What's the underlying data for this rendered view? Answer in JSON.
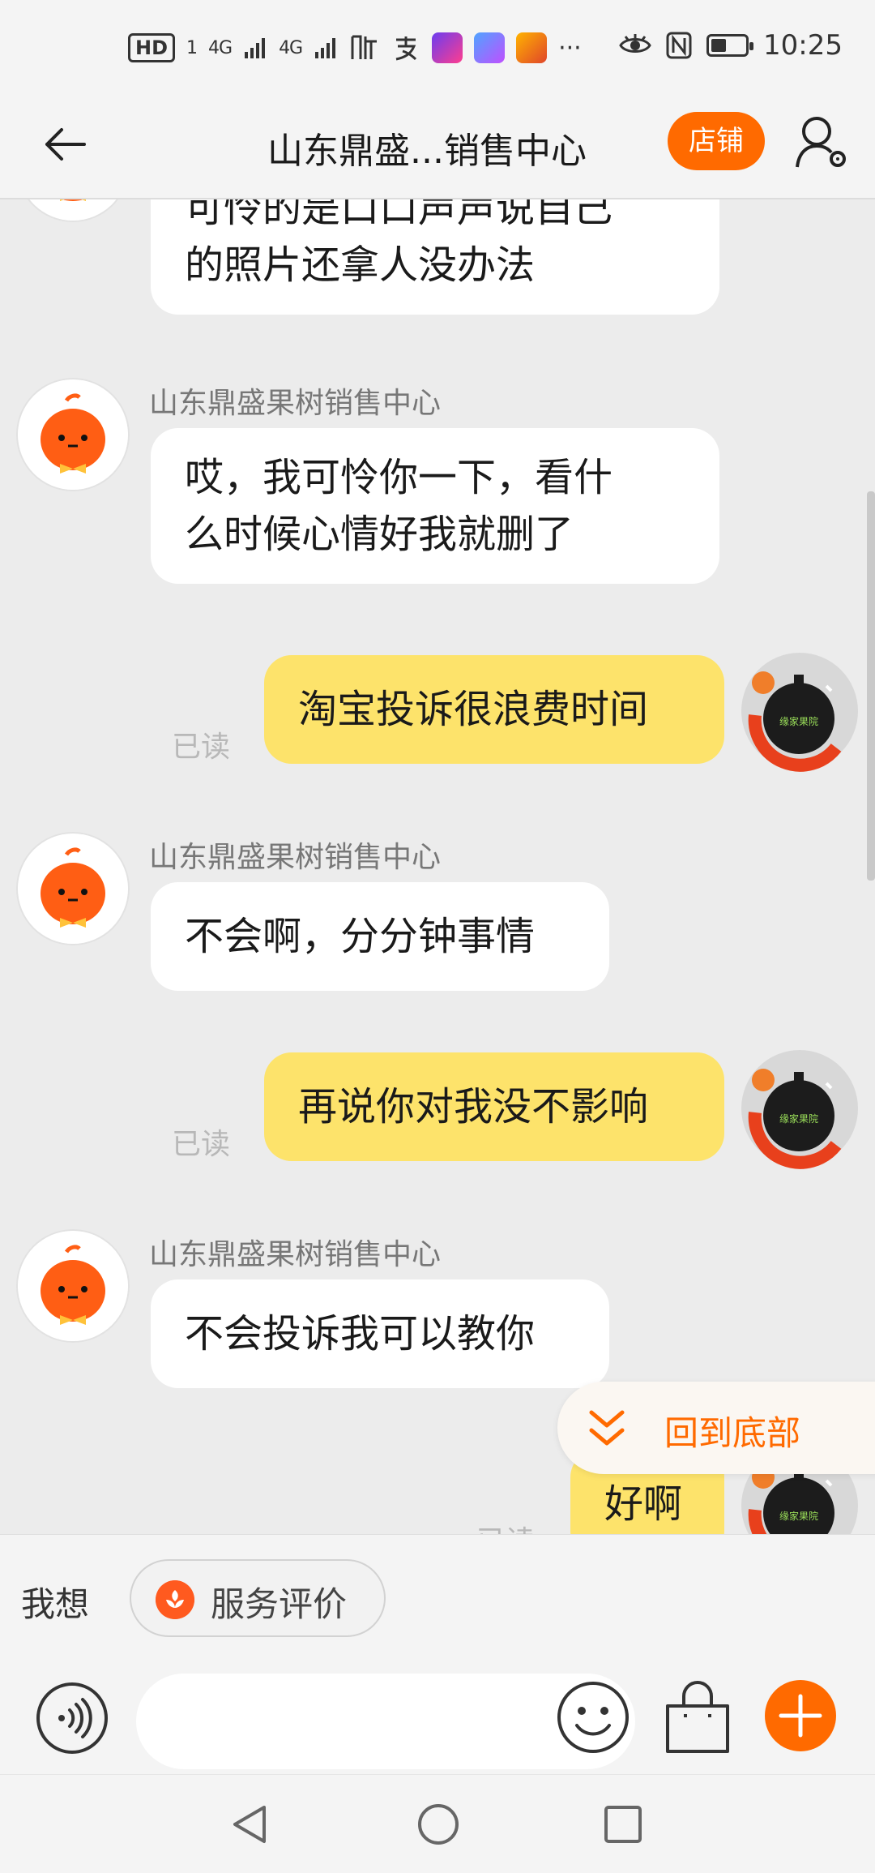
{
  "status_bar": {
    "network_badge": "HD",
    "network_sub": "1",
    "signal_1": "4G",
    "signal_2": "4G",
    "more": "···",
    "time": "10:25",
    "battery_level": 0.45
  },
  "header": {
    "title": "山东鼎盛...销售中心",
    "shop_button": "店铺"
  },
  "messages": [
    {
      "side": "in",
      "text_line1": "可怜的是口口声声说自己",
      "text_line2": "的照片还拿人没办法"
    },
    {
      "side": "in",
      "sender": "山东鼎盛果树销售中心",
      "text_line1": "哎，我可怜你一下，看什",
      "text_line2": "么时候心情好我就删了"
    },
    {
      "side": "out",
      "text": "淘宝投诉很浪费时间",
      "status": "已读"
    },
    {
      "side": "in",
      "sender": "山东鼎盛果树销售中心",
      "text": "不会啊，分分钟事情"
    },
    {
      "side": "out",
      "text": "再说你对我没不影响",
      "status": "已读"
    },
    {
      "side": "in",
      "sender": "山东鼎盛果树销售中心",
      "text": "不会投诉我可以教你"
    },
    {
      "side": "out",
      "text": "好啊",
      "status": "已读"
    }
  ],
  "user_avatar_text": "缘家果院",
  "back_to_bottom": "回到底部",
  "quick_reply": {
    "label": "我想",
    "chip": "服务评价"
  },
  "input": {
    "placeholder": ""
  },
  "colors": {
    "accent": "#ff6a00",
    "outgoing_bubble": "#fde36b",
    "incoming_bubble": "#ffffff",
    "background": "#ececec"
  }
}
